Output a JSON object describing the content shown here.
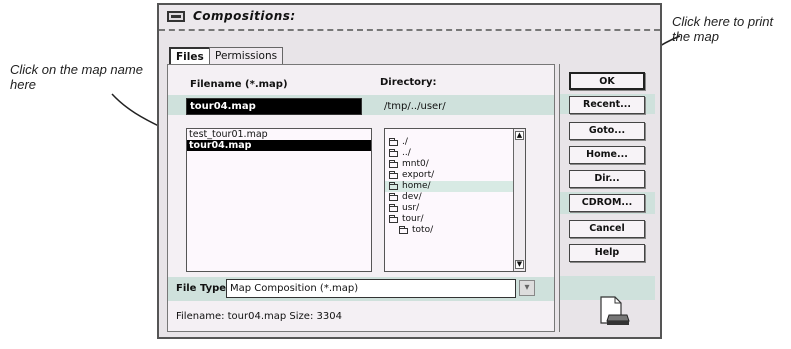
{
  "annotations": {
    "left": "Click on the map name here",
    "right": "Click here to print the map"
  },
  "dialog": {
    "title": "Compositions:",
    "tabs": [
      "Files",
      "Permissions"
    ],
    "filename_label": "Filename (*.map)",
    "filename_value": "tour04.map",
    "directory_label": "Directory:",
    "directory_value": "/tmp/../user/",
    "files": [
      "test_tour01.map",
      "tour04.map"
    ],
    "selected_file": "tour04.map",
    "directories": [
      "./",
      "../",
      "mnt0/",
      "export/",
      "home/",
      "dev/",
      "usr/",
      "tour/",
      "toto/"
    ],
    "filetype_label": "File Type:",
    "filetype_value": "Map Composition (*.map)",
    "file_info": "Filename: tour04.map     Size: 3304",
    "buttons": [
      "OK",
      "Recent...",
      "Goto...",
      "Home...",
      "Dir...",
      "CDROM...",
      "Cancel",
      "Help"
    ]
  },
  "colors": {
    "band": "#cfe1dc",
    "dialog_bg": "#e8e4e8"
  },
  "icons": {
    "title": "window-menu-icon",
    "document": "print-document-icon",
    "folder": "folder-icon"
  }
}
